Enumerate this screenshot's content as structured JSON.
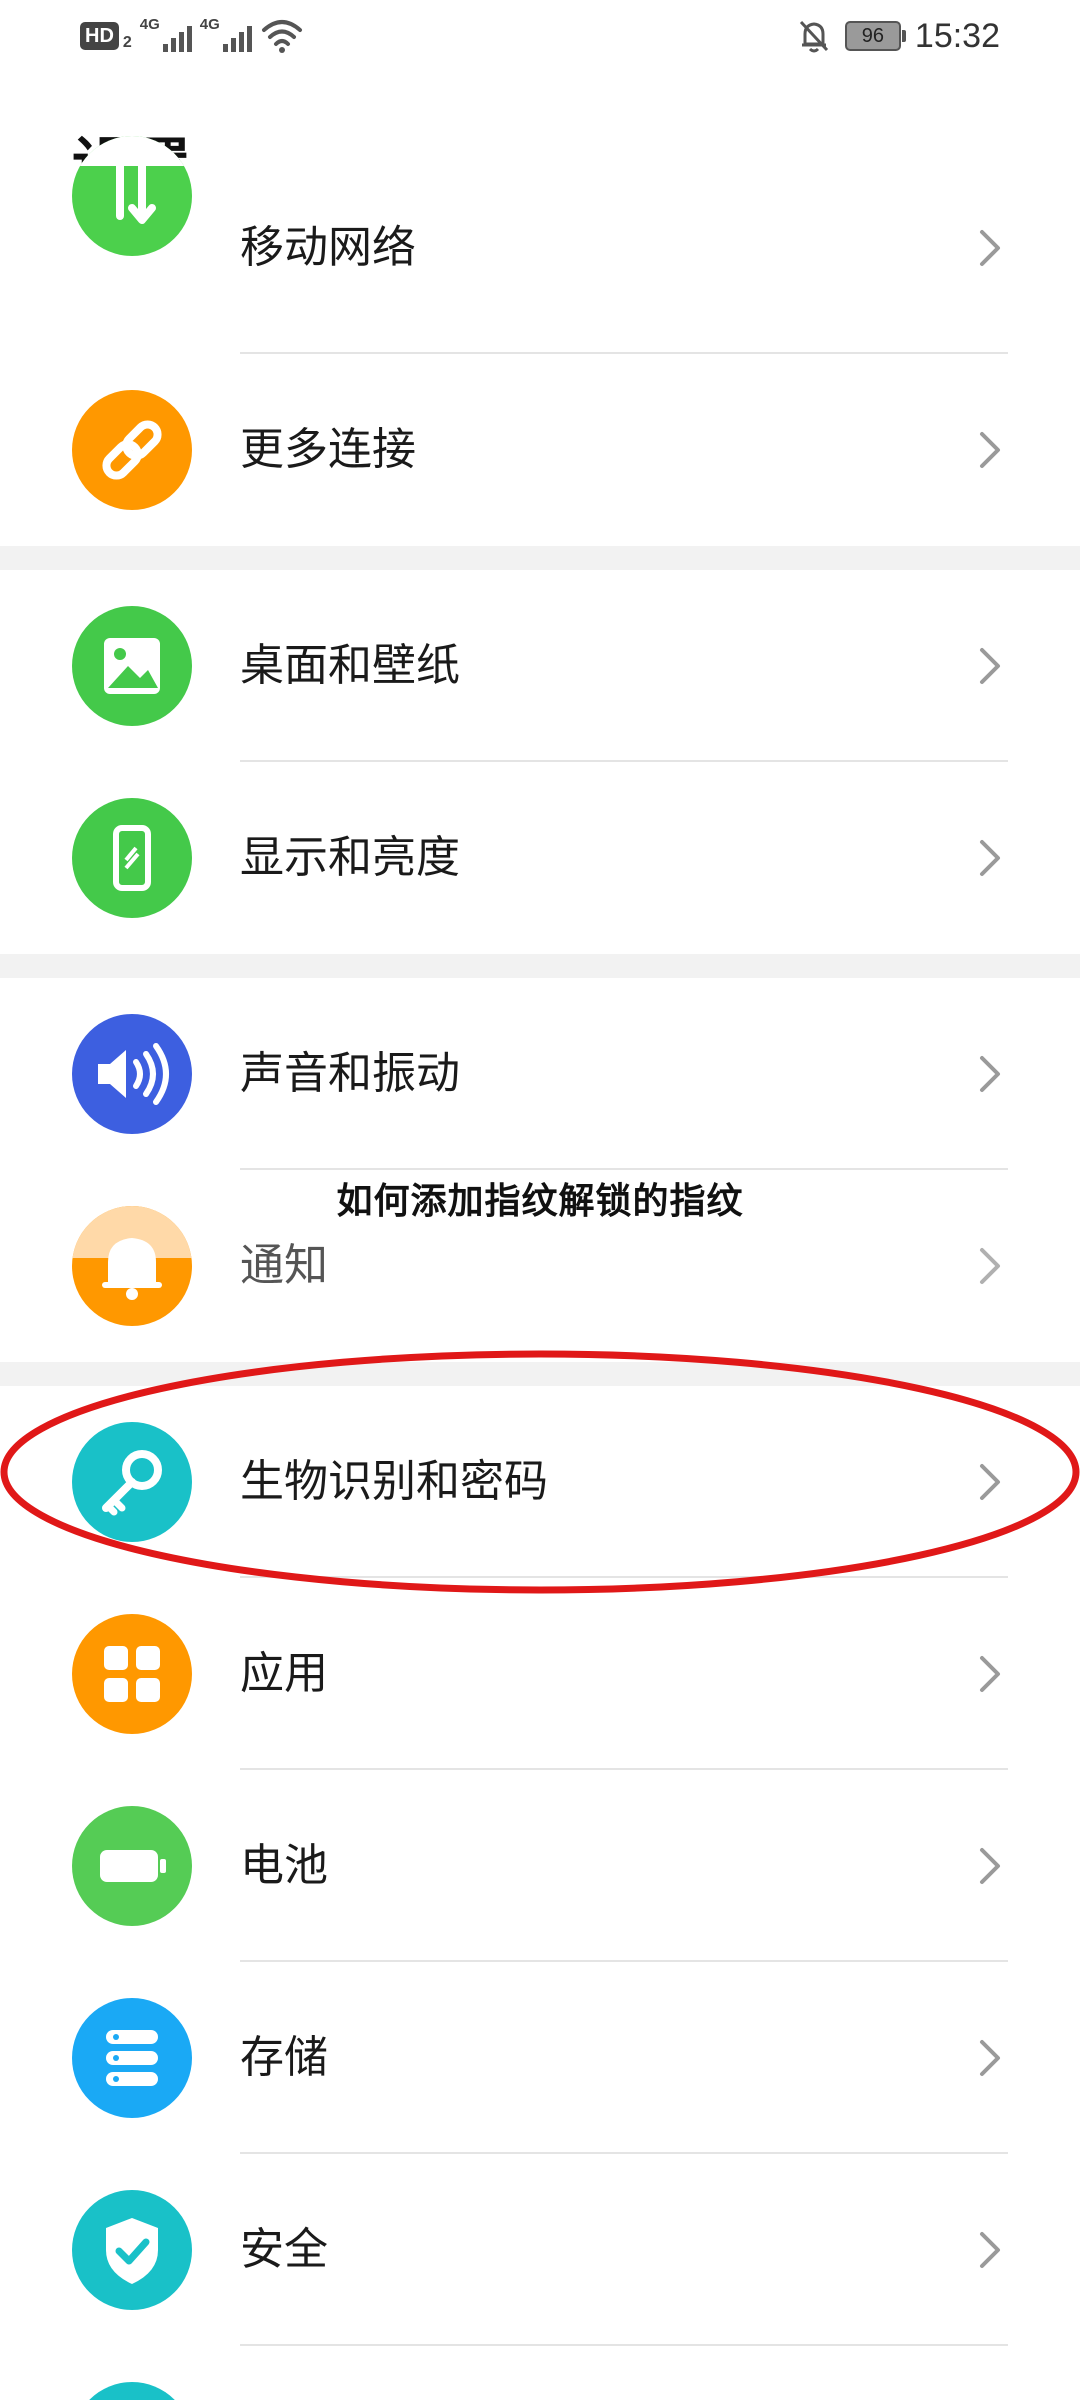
{
  "status_bar": {
    "hd_label": "HD",
    "hd_sub": "2",
    "network_1": "4G",
    "network_2": "4G",
    "battery_level": "96",
    "time": "15:32",
    "icons": [
      "wifi-icon",
      "bell-off-icon",
      "battery-icon"
    ]
  },
  "page": {
    "title": "设置"
  },
  "items": [
    {
      "label": "移动网络",
      "icon": "mobile-network-icon",
      "color": "#4cd04c"
    },
    {
      "label": "更多连接",
      "icon": "link-icon",
      "color": "#ff9800"
    },
    {
      "label": "桌面和壁纸",
      "icon": "image-icon",
      "color": "#44c94a"
    },
    {
      "label": "显示和亮度",
      "icon": "phone-display-icon",
      "color": "#44c94a"
    },
    {
      "label": "声音和振动",
      "icon": "speaker-icon",
      "color": "#3d5fe0"
    },
    {
      "label": "通知",
      "icon": "bell-icon",
      "color": "#ff9800"
    },
    {
      "label": "生物识别和密码",
      "icon": "key-icon",
      "color": "#19c1c8"
    },
    {
      "label": "应用",
      "icon": "apps-grid-icon",
      "color": "#ff9800"
    },
    {
      "label": "电池",
      "icon": "battery-icon",
      "color": "#55cc55"
    },
    {
      "label": "存储",
      "icon": "storage-icon",
      "color": "#1aa9f5"
    },
    {
      "label": "安全",
      "icon": "shield-check-icon",
      "color": "#19c1c8"
    }
  ],
  "overlay": {
    "caption": "如何添加指纹解锁的指纹"
  },
  "annotation": {
    "color": "#e01818",
    "shape": "ellipse"
  }
}
